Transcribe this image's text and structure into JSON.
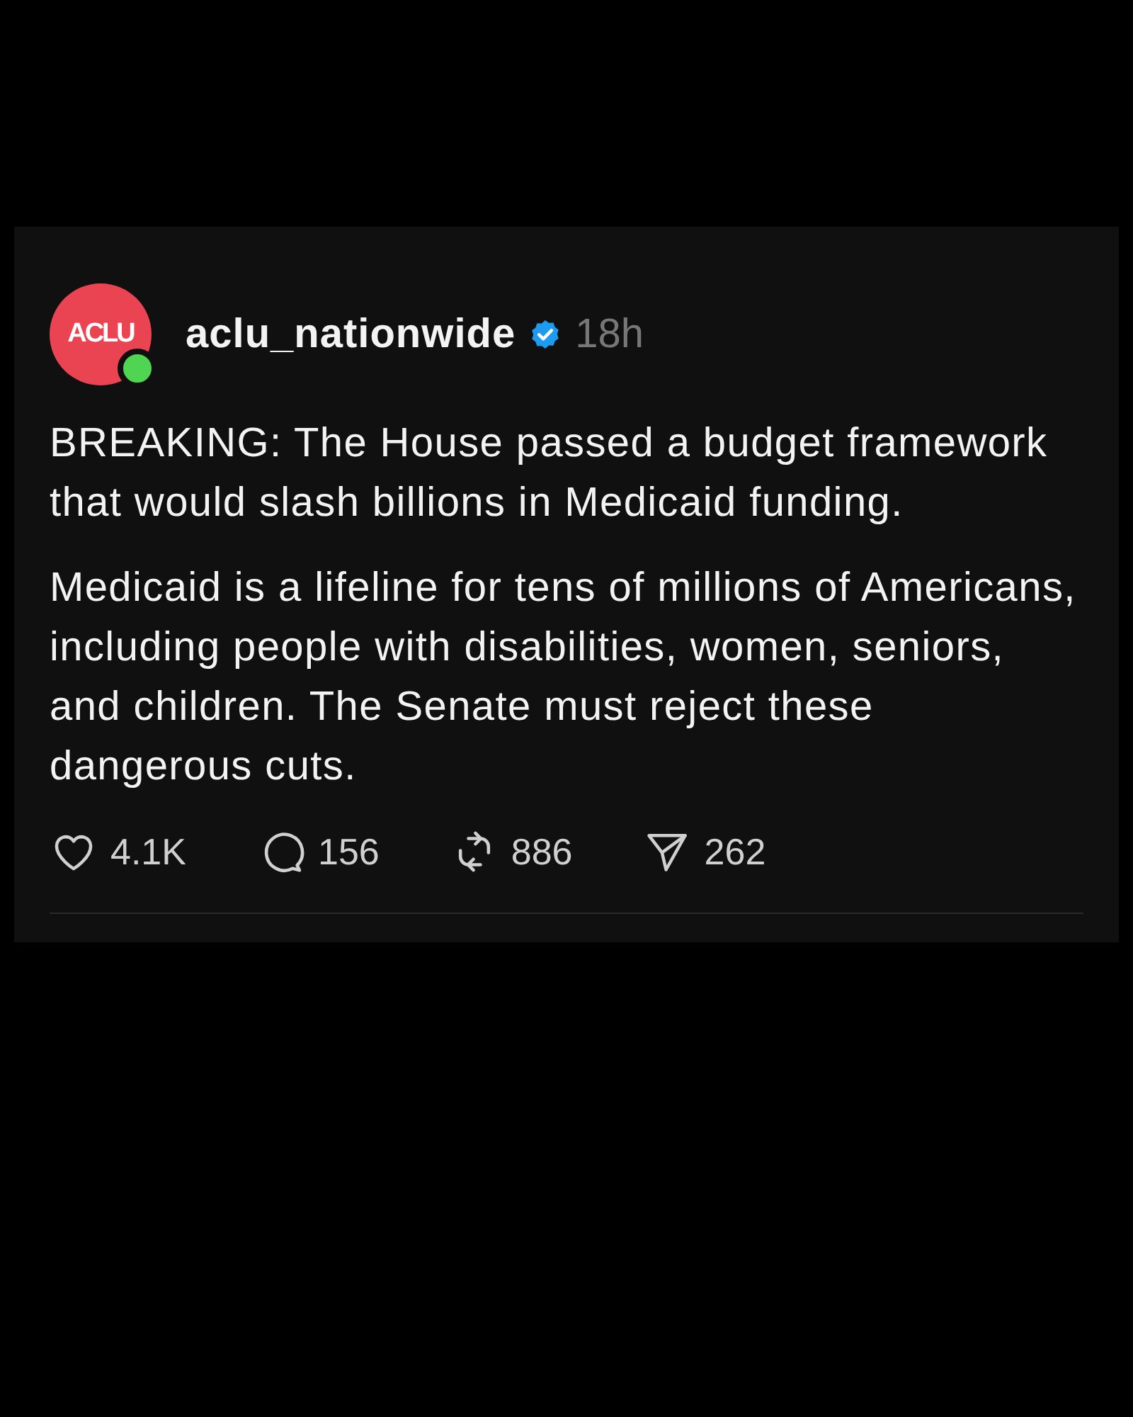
{
  "post": {
    "author": {
      "logo_text": "ACLU",
      "online": true,
      "username": "aclu_nationwide",
      "verified": true,
      "time": "18h"
    },
    "paragraphs": [
      [
        "BREAKING: The House passed a budget framework",
        "that would slash billions in Medicaid funding."
      ],
      [
        "Medicaid is a lifeline for tens of millions of Americans,",
        "including people with disabilities, women, seniors,",
        "and children. The Senate must reject these",
        "dangerous cuts."
      ]
    ],
    "actions": [
      {
        "kind": "like",
        "count": "4.1K"
      },
      {
        "kind": "reply",
        "count": "156"
      },
      {
        "kind": "repost",
        "count": "886"
      },
      {
        "kind": "share",
        "count": "262"
      }
    ]
  }
}
